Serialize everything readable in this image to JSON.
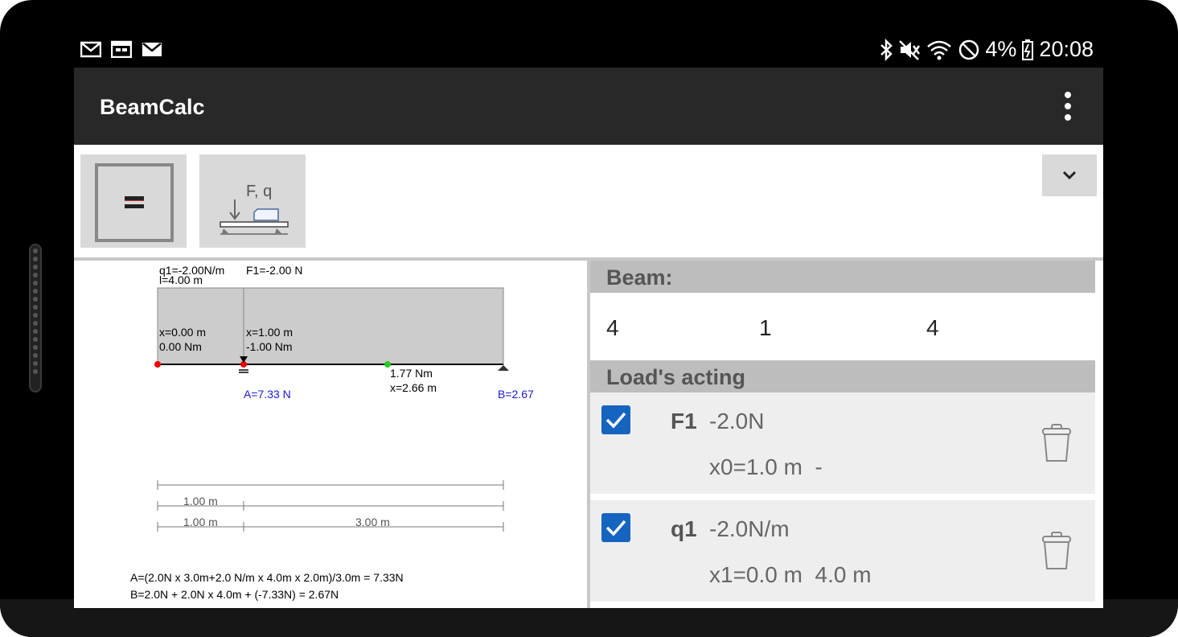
{
  "status_bar": {
    "battery": "4%",
    "time": "20:08",
    "left_icons": [
      "mail-icon",
      "calendar-icon",
      "mail-icon"
    ],
    "right_icons": [
      "bluetooth-icon",
      "mute-icon",
      "wifi-icon",
      "dnd-icon",
      "battery-icon"
    ]
  },
  "app_bar": {
    "title": "BeamCalc"
  },
  "toolbar": {
    "calc_icon": "equals-icon",
    "load_icon": "load-icon",
    "load_icon_label": "F, q"
  },
  "diagram": {
    "q_label": "q1=-2.00N/m",
    "f_label": "F1=-2.00 N",
    "l_label": "l=4.00 m",
    "point1_x": "x=0.00 m",
    "point1_m": "0.00 Nm",
    "point2_x": "x=1.00 m",
    "point2_m": "-1.00 Nm",
    "max_m": "1.77 Nm",
    "max_x": "x=2.66 m",
    "reaction_a": "A=7.33 N",
    "reaction_b": "B=2.67",
    "dim1": "1.00 m",
    "dim2": "1.00 m",
    "dim3": "3.00 m",
    "formula_a": "A=(2.0N x 3.0m+2.0 N/m x 4.0m x 2.0m)/3.0m = 7.33N",
    "formula_b": "B=2.0N + 2.0N x 4.0m + (-7.33N) = 2.67N"
  },
  "beam_section": {
    "title": "Beam:",
    "values": [
      "4",
      "1",
      "4"
    ]
  },
  "loads_section": {
    "title": "Load's acting",
    "loads": [
      {
        "name": "F1",
        "value": "-2.0N",
        "position": "x0=1.0 m  -"
      },
      {
        "name": "q1",
        "value": "-2.0N/m",
        "position": "x1=0.0 m  4.0 m"
      }
    ]
  },
  "colors": {
    "accent": "#1565c0",
    "appbar": "#282828",
    "header": "#bdbdbd",
    "card": "#eeeeee"
  }
}
